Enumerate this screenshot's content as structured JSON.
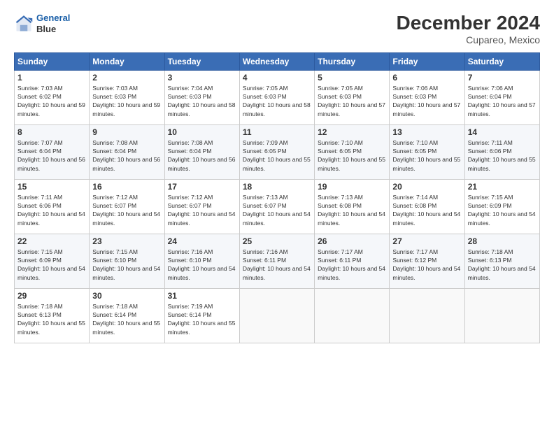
{
  "logo": {
    "line1": "General",
    "line2": "Blue"
  },
  "title": "December 2024",
  "subtitle": "Cupareo, Mexico",
  "days_of_week": [
    "Sunday",
    "Monday",
    "Tuesday",
    "Wednesday",
    "Thursday",
    "Friday",
    "Saturday"
  ],
  "weeks": [
    [
      {
        "day": "1",
        "sunrise": "7:03 AM",
        "sunset": "6:02 PM",
        "daylight": "10 hours and 59 minutes."
      },
      {
        "day": "2",
        "sunrise": "7:03 AM",
        "sunset": "6:03 PM",
        "daylight": "10 hours and 59 minutes."
      },
      {
        "day": "3",
        "sunrise": "7:04 AM",
        "sunset": "6:03 PM",
        "daylight": "10 hours and 58 minutes."
      },
      {
        "day": "4",
        "sunrise": "7:05 AM",
        "sunset": "6:03 PM",
        "daylight": "10 hours and 58 minutes."
      },
      {
        "day": "5",
        "sunrise": "7:05 AM",
        "sunset": "6:03 PM",
        "daylight": "10 hours and 57 minutes."
      },
      {
        "day": "6",
        "sunrise": "7:06 AM",
        "sunset": "6:03 PM",
        "daylight": "10 hours and 57 minutes."
      },
      {
        "day": "7",
        "sunrise": "7:06 AM",
        "sunset": "6:04 PM",
        "daylight": "10 hours and 57 minutes."
      }
    ],
    [
      {
        "day": "8",
        "sunrise": "7:07 AM",
        "sunset": "6:04 PM",
        "daylight": "10 hours and 56 minutes."
      },
      {
        "day": "9",
        "sunrise": "7:08 AM",
        "sunset": "6:04 PM",
        "daylight": "10 hours and 56 minutes."
      },
      {
        "day": "10",
        "sunrise": "7:08 AM",
        "sunset": "6:04 PM",
        "daylight": "10 hours and 56 minutes."
      },
      {
        "day": "11",
        "sunrise": "7:09 AM",
        "sunset": "6:05 PM",
        "daylight": "10 hours and 55 minutes."
      },
      {
        "day": "12",
        "sunrise": "7:10 AM",
        "sunset": "6:05 PM",
        "daylight": "10 hours and 55 minutes."
      },
      {
        "day": "13",
        "sunrise": "7:10 AM",
        "sunset": "6:05 PM",
        "daylight": "10 hours and 55 minutes."
      },
      {
        "day": "14",
        "sunrise": "7:11 AM",
        "sunset": "6:06 PM",
        "daylight": "10 hours and 55 minutes."
      }
    ],
    [
      {
        "day": "15",
        "sunrise": "7:11 AM",
        "sunset": "6:06 PM",
        "daylight": "10 hours and 54 minutes."
      },
      {
        "day": "16",
        "sunrise": "7:12 AM",
        "sunset": "6:07 PM",
        "daylight": "10 hours and 54 minutes."
      },
      {
        "day": "17",
        "sunrise": "7:12 AM",
        "sunset": "6:07 PM",
        "daylight": "10 hours and 54 minutes."
      },
      {
        "day": "18",
        "sunrise": "7:13 AM",
        "sunset": "6:07 PM",
        "daylight": "10 hours and 54 minutes."
      },
      {
        "day": "19",
        "sunrise": "7:13 AM",
        "sunset": "6:08 PM",
        "daylight": "10 hours and 54 minutes."
      },
      {
        "day": "20",
        "sunrise": "7:14 AM",
        "sunset": "6:08 PM",
        "daylight": "10 hours and 54 minutes."
      },
      {
        "day": "21",
        "sunrise": "7:15 AM",
        "sunset": "6:09 PM",
        "daylight": "10 hours and 54 minutes."
      }
    ],
    [
      {
        "day": "22",
        "sunrise": "7:15 AM",
        "sunset": "6:09 PM",
        "daylight": "10 hours and 54 minutes."
      },
      {
        "day": "23",
        "sunrise": "7:15 AM",
        "sunset": "6:10 PM",
        "daylight": "10 hours and 54 minutes."
      },
      {
        "day": "24",
        "sunrise": "7:16 AM",
        "sunset": "6:10 PM",
        "daylight": "10 hours and 54 minutes."
      },
      {
        "day": "25",
        "sunrise": "7:16 AM",
        "sunset": "6:11 PM",
        "daylight": "10 hours and 54 minutes."
      },
      {
        "day": "26",
        "sunrise": "7:17 AM",
        "sunset": "6:11 PM",
        "daylight": "10 hours and 54 minutes."
      },
      {
        "day": "27",
        "sunrise": "7:17 AM",
        "sunset": "6:12 PM",
        "daylight": "10 hours and 54 minutes."
      },
      {
        "day": "28",
        "sunrise": "7:18 AM",
        "sunset": "6:13 PM",
        "daylight": "10 hours and 54 minutes."
      }
    ],
    [
      {
        "day": "29",
        "sunrise": "7:18 AM",
        "sunset": "6:13 PM",
        "daylight": "10 hours and 55 minutes."
      },
      {
        "day": "30",
        "sunrise": "7:18 AM",
        "sunset": "6:14 PM",
        "daylight": "10 hours and 55 minutes."
      },
      {
        "day": "31",
        "sunrise": "7:19 AM",
        "sunset": "6:14 PM",
        "daylight": "10 hours and 55 minutes."
      },
      null,
      null,
      null,
      null
    ]
  ]
}
